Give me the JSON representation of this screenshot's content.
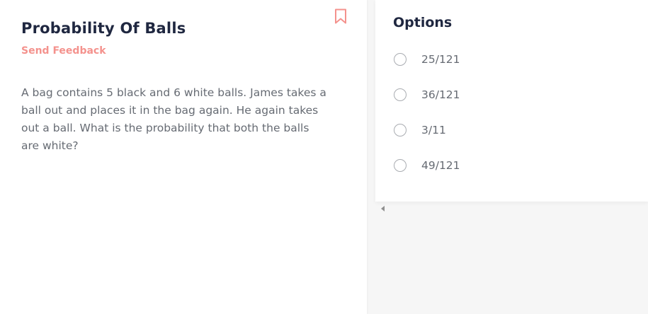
{
  "problem": {
    "title": "Probability Of Balls",
    "feedback_label": "Send Feedback",
    "question": "A bag contains 5 black and 6 white balls. James takes a ball out and places it in the bag again. He again takes out a ball. What is the probability that both the balls are white?"
  },
  "options": {
    "title": "Options",
    "items": [
      {
        "label": "25/121"
      },
      {
        "label": "36/121"
      },
      {
        "label": "3/11"
      },
      {
        "label": "49/121"
      }
    ]
  },
  "icons": {
    "bookmark": "bookmark-icon",
    "scroll_left": "scroll-left-arrow-icon"
  },
  "colors": {
    "title": "#1f2740",
    "accent": "#f4928d",
    "body_text": "#666b73"
  }
}
